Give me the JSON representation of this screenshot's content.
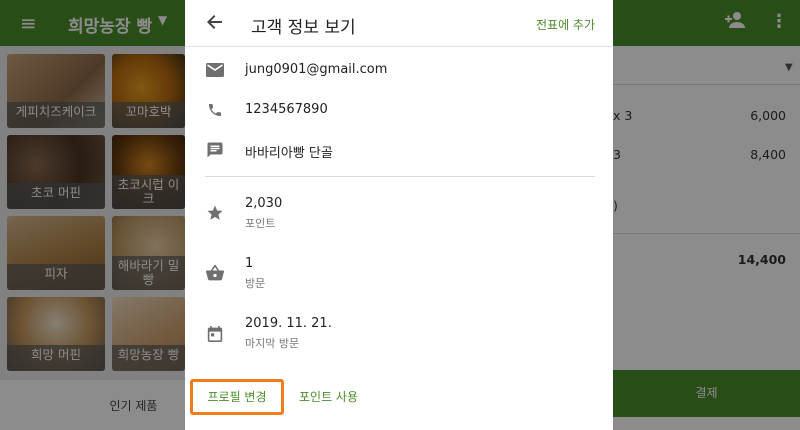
{
  "app": {
    "store_name": "희망농장 빵",
    "icons": {
      "menu": "menu-icon",
      "store_dropdown": "caret-down-icon",
      "add_customer": "person-add-icon",
      "more": "more-vert-icon"
    },
    "accent_color": "#4c8c2b",
    "products": [
      {
        "label": "게피치즈케이크"
      },
      {
        "label": "꼬마호박"
      },
      {
        "label": "초코 머핀"
      },
      {
        "label": "초코시럽 이크"
      },
      {
        "label": "피자"
      },
      {
        "label": "해바라기 밀빵"
      },
      {
        "label": "희망 머핀"
      },
      {
        "label": "희망농장 빵"
      }
    ],
    "bottom_tab": "인기 제품",
    "order": {
      "items": [
        {
          "name": "x 3",
          "amount": "6,000"
        },
        {
          "name": "3",
          "amount": "8,400"
        },
        {
          "name": ")",
          "amount": ""
        }
      ],
      "total": "14,400"
    },
    "pay_button": "결제"
  },
  "dialog": {
    "title": "고객 정보 보기",
    "back_icon": "arrow-back-icon",
    "add_to_slip": "전표에 추가",
    "contact": {
      "email": "jung0901@gmail.com",
      "phone": "1234567890",
      "memo": "바바리아빵 단골"
    },
    "stats": {
      "points_value": "2,030",
      "points_label": "포인트",
      "visits_value": "1",
      "visits_label": "방문",
      "last_visit_value": "2019. 11. 21.",
      "last_visit_label": "마지막 방문"
    },
    "buttons": {
      "change_profile": "프로필 변경",
      "use_points": "포인트 사용"
    },
    "highlight_color": "#f07c1c"
  }
}
